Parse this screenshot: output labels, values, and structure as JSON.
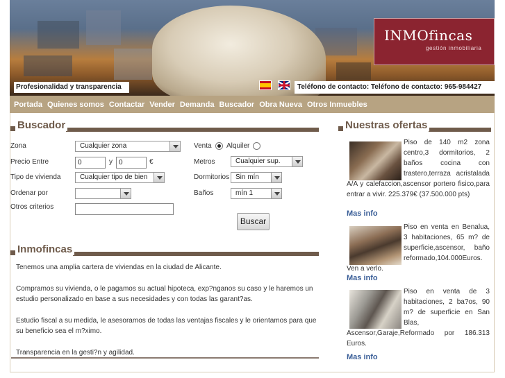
{
  "header": {
    "logo_name": "INMOfincas",
    "logo_sub": "gestión inmobiliaria",
    "tagline": "Profesionalidad y transparencia",
    "phone": "Teléfono de contacto: Teléfono de contacto: 965-984427",
    "brand_color": "#8b2430"
  },
  "nav": {
    "items": [
      "Portada",
      "Quienes somos",
      "Contactar",
      "Vender",
      "Demanda",
      "Buscador",
      "Obra Nueva",
      "Otros Inmuebles"
    ],
    "bg_color": "#b7a382"
  },
  "buscador": {
    "title": "Buscador",
    "zona_label": "Zona",
    "zona_value": "Cualquier zona",
    "precio_label": "Precio Entre",
    "precio_min": "0",
    "precio_y": "y",
    "precio_max": "0",
    "currency": "€",
    "tipo_label": "Tipo de vivienda",
    "tipo_value": "Cualquier tipo de bien",
    "ordenar_label": "Ordenar por",
    "ordenar_value": "",
    "otros_label": "Otros criterios",
    "otros_value": "",
    "venta_label": "Venta",
    "alquiler_label": "Alquiler",
    "selected_operation": "Venta",
    "metros_label": "Metros",
    "metros_value": "Cualquier sup.",
    "dormitorios_label": "Dormitorios",
    "dormitorios_value": "Sin mín",
    "banos_label": "Baños",
    "banos_value": "mín 1",
    "button_label": "Buscar"
  },
  "inmofincas": {
    "title": "Inmofincas",
    "paragraphs": [
      "Tenemos una amplia cartera de viviendas en la ciudad de Alicante.",
      "Compramos su vivienda, o le pagamos su actual hipoteca, exp?nganos su caso y le haremos un estudio personalizado en base a sus necesidades y con todas las garant?as.",
      "Estudio fiscal a su medida, le asesoramos de todas las ventajas fiscales y le orientamos para que su beneficio sea el m?ximo.",
      "Transparencia en la gesti?n y agilidad."
    ]
  },
  "ofertas": {
    "title": "Nuestras ofertas",
    "items": [
      {
        "text": "Piso de 140 m2 zona centro,3 dormitorios, 2 baños cocina con trastero,terraza acristalada A/A y calefaccion,ascensor portero fisico,para entrar a vivir. 225.379€ (37.500.000 pts)",
        "link": "Mas info"
      },
      {
        "text": "Piso en venta en Benalua, 3 habitaciones, 65 m? de superficie,ascensor, baño reformado,104.000Euros. Ven a verlo.",
        "link": "Mas info"
      },
      {
        "text": "Piso en venta de 3 habitaciones, 2 ba?os, 90 m? de superficie en San Blas, Ascensor,Garaje,Reformado por 186.313 Euros.",
        "link": "Mas info"
      }
    ]
  },
  "accent_color": "#6f5b4b",
  "link_color": "#3b5f98"
}
